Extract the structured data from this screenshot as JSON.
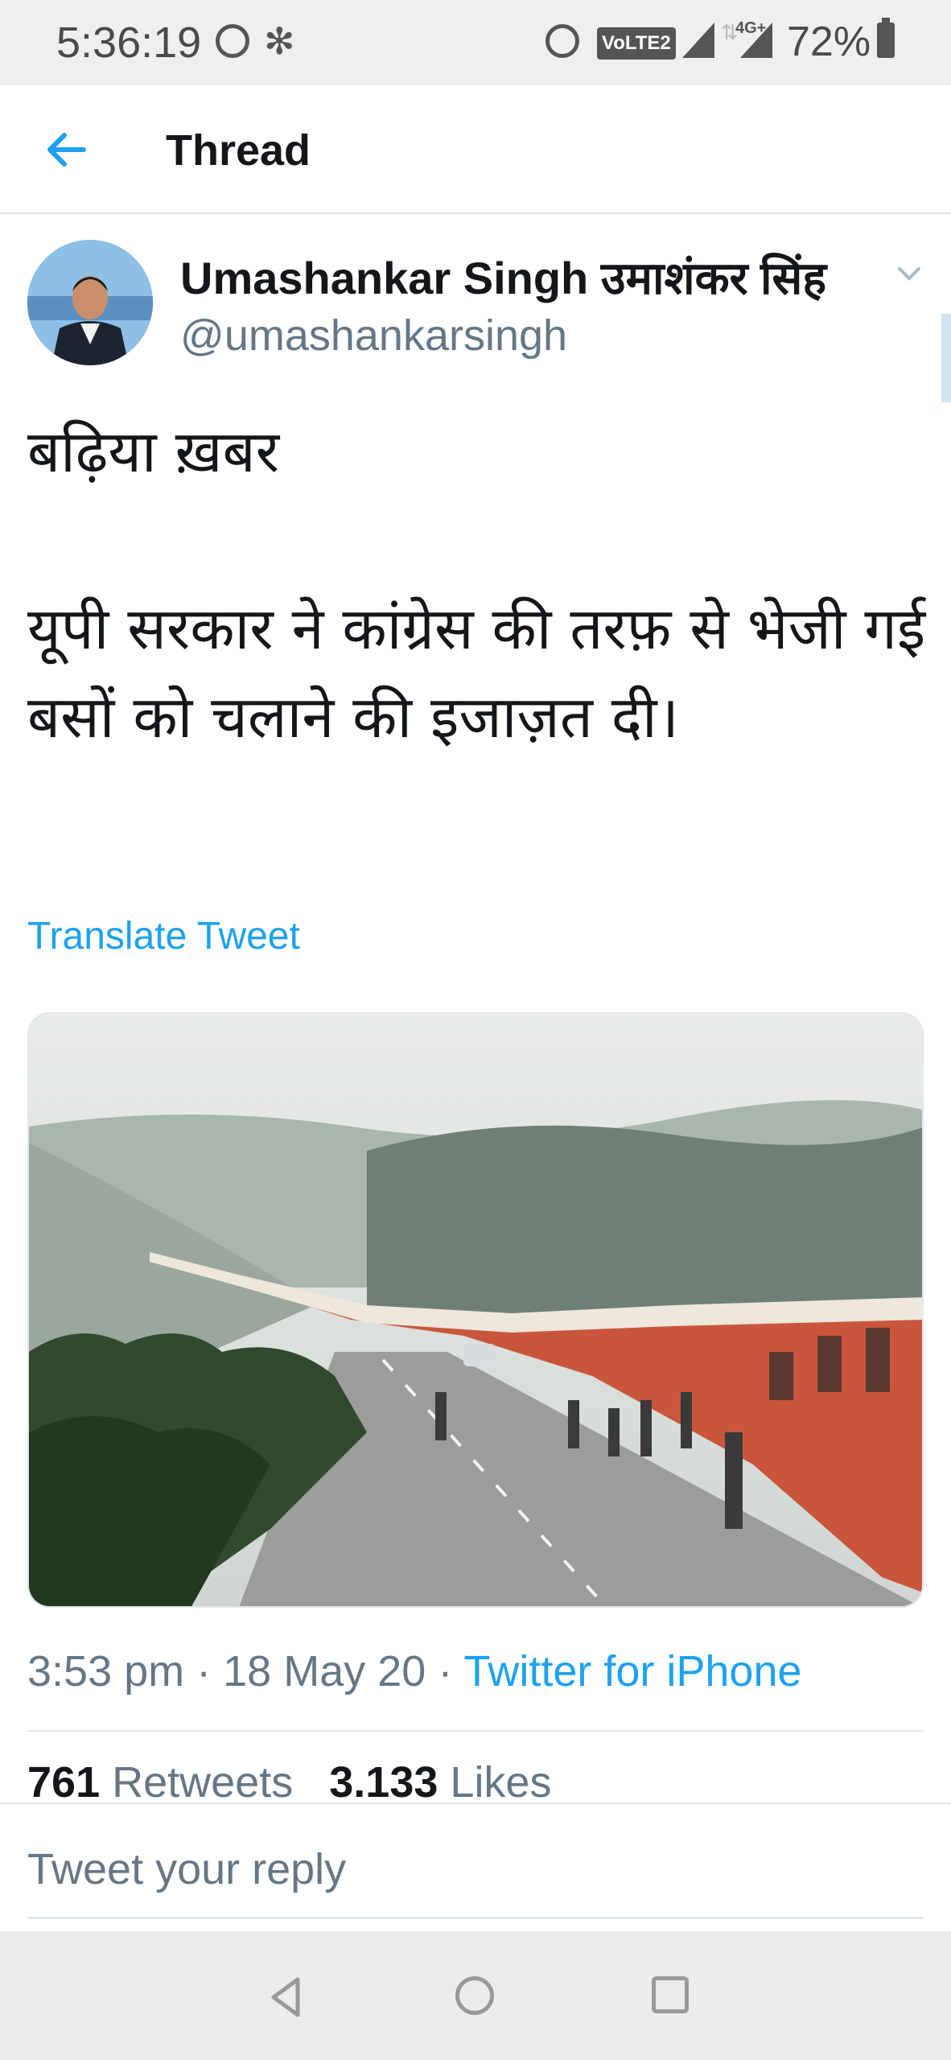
{
  "status_bar": {
    "time": "5:36:19",
    "network_badge": "VoLTE2",
    "network_type": "4G+",
    "battery": "72%",
    "icons": [
      "whatsapp-icon",
      "slack-icon",
      "alarm-icon",
      "signal-icon",
      "battery-icon"
    ]
  },
  "header": {
    "title": "Thread",
    "back_icon": "back-arrow-icon"
  },
  "tweet": {
    "author_name": "Umashankar Singh उमाशंकर सिंह",
    "author_handle": "@umashankarsingh",
    "text": "बढ़िया ख़बर\n\nयूपी सरकार ने कांग्रेस की तरफ़ से भेजी गई बसों को चलाने की इजाज़त दी।",
    "translate_label": "Translate Tweet",
    "time": "3:53 pm",
    "date": "18 May 20",
    "source": "Twitter for iPhone",
    "retweets_count": "761",
    "retweets_label": "Retweets",
    "likes_count": "3.133",
    "likes_label": "Likes"
  },
  "reply": {
    "placeholder": "Tweet your reply"
  },
  "colors": {
    "accent": "#1da1f2",
    "text_primary": "#14171a",
    "text_secondary": "#657786",
    "divider": "#e1e8ed",
    "status_bar_bg": "#efefef",
    "nav_bar_bg": "#ececec"
  }
}
